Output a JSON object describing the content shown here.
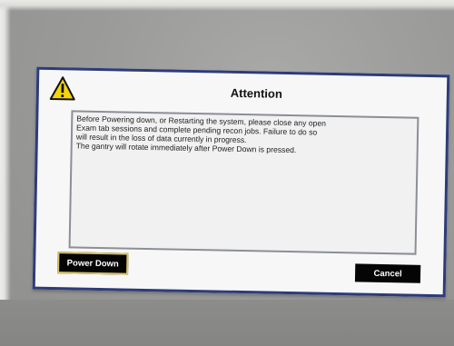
{
  "dialog": {
    "title": "Attention",
    "icon": "warning-icon",
    "message": "Before Powering down, or Restarting the system, please close any open\nExam tab sessions and complete pending recon jobs. Failure to do so\nwill result in the loss of data currently in progress.\nThe gantry will rotate immediately after Power Down is pressed.",
    "buttons": {
      "power_down": "Power Down",
      "cancel": "Cancel"
    }
  },
  "colors": {
    "dialog_border": "#2d3b7a",
    "warning_yellow": "#f5d50a",
    "button_bg": "#050505",
    "focus_outline": "#d7c36a"
  }
}
